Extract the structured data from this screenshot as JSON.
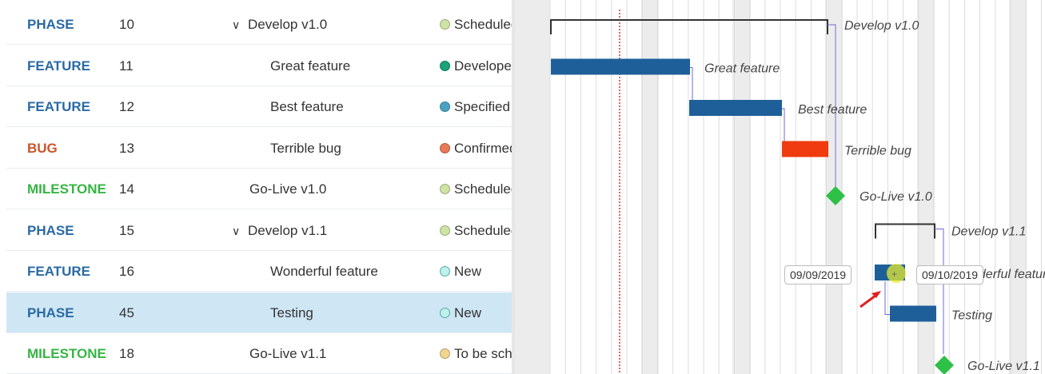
{
  "colors": {
    "phase": "#2a6aa3",
    "feature": "#2a6aa3",
    "bug": "#c8552a",
    "milestone": "#35b544",
    "bar": "#1f5f99",
    "bug_bar": "#f03a10",
    "milestone_diamond": "#2ec047",
    "today_line": "#e03030",
    "selected_row": "#cfe6f5"
  },
  "rows": [
    {
      "type": "PHASE",
      "id": "10",
      "subject": "Develop v1.0",
      "expandable": true,
      "indent": 0,
      "status": "Scheduled",
      "status_color": "#cfe3a5",
      "status_hollow": false
    },
    {
      "type": "FEATURE",
      "id": "11",
      "subject": "Great feature",
      "expandable": false,
      "indent": 1,
      "status": "Developed",
      "status_color": "#1aa27a",
      "status_hollow": false
    },
    {
      "type": "FEATURE",
      "id": "12",
      "subject": "Best feature",
      "expandable": false,
      "indent": 1,
      "status": "Specified",
      "status_color": "#4aa3c4",
      "status_hollow": false
    },
    {
      "type": "BUG",
      "id": "13",
      "subject": "Terrible bug",
      "expandable": false,
      "indent": 1,
      "status": "Confirmed",
      "status_color": "#e87a55",
      "status_hollow": false
    },
    {
      "type": "MILESTONE",
      "id": "14",
      "subject": "Go-Live v1.0",
      "expandable": false,
      "indent": 0,
      "status": "Scheduled",
      "status_color": "#cfe3a5",
      "status_hollow": false
    },
    {
      "type": "PHASE",
      "id": "15",
      "subject": "Develop v1.1",
      "expandable": true,
      "indent": 0,
      "status": "Scheduled",
      "status_color": "#cfe3a5",
      "status_hollow": false
    },
    {
      "type": "FEATURE",
      "id": "16",
      "subject": "Wonderful feature",
      "expandable": false,
      "indent": 1,
      "status": "New",
      "status_color": "#bff0ea",
      "status_hollow": true
    },
    {
      "type": "PHASE",
      "id": "45",
      "subject": "Testing",
      "expandable": false,
      "indent": 1,
      "status": "New",
      "status_color": "#bff0ea",
      "status_hollow": true,
      "selected": true
    },
    {
      "type": "MILESTONE",
      "id": "18",
      "subject": "Go-Live v1.1",
      "expandable": false,
      "indent": 0,
      "status": "To be scheduled",
      "status_color": "#f0d590",
      "status_hollow": false
    }
  ],
  "gantt": {
    "labels": [
      "Develop v1.0",
      "Great feature",
      "Best feature",
      "Terrible bug",
      "Go-Live v1.0",
      "Develop v1.1",
      "Wonderful feature",
      "Testing",
      "Go-Live v1.1"
    ],
    "tooltip_start": "09/09/2019",
    "tooltip_end": "09/10/2019"
  }
}
